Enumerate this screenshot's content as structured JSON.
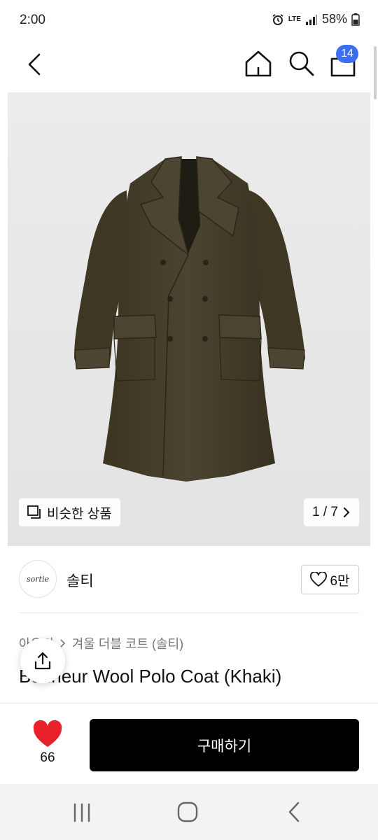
{
  "status_bar": {
    "time": "2:00",
    "network": "LTE",
    "battery": "58%"
  },
  "nav": {
    "cart_count": "14",
    "icons": [
      "back-arrow-icon",
      "home-icon",
      "search-icon",
      "cart-icon"
    ]
  },
  "gallery": {
    "similar_label": "비슷한 상품",
    "pager": "1 / 7",
    "current_page": 1,
    "total_pages": 7
  },
  "shop": {
    "logo_text": "sortie",
    "name": "솔티",
    "like_count": "6만"
  },
  "product": {
    "breadcrumb": [
      "아우터",
      "겨울 더블 코트 (솔티)"
    ],
    "title": "Bonheur Wool Polo Coat (Khaki)"
  },
  "bottom": {
    "like_count": "66",
    "buy_label": "구매하기"
  },
  "colors": {
    "accent_blue": "#3b6ef5",
    "heart_red": "#e8202a",
    "buy_button": "#000000",
    "coat_khaki": "#433d27"
  }
}
